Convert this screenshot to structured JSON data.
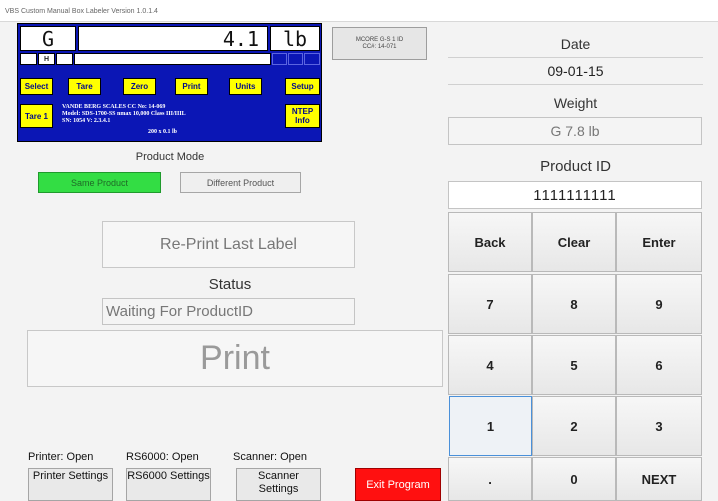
{
  "window": {
    "title": "VBS Custom Manual Box Labeler Version 1.0.1.4"
  },
  "indicator": {
    "mode_letter": "G",
    "weight": "4.1",
    "unit": "lb",
    "annunciator": "H",
    "keys": {
      "select": "Select",
      "tare": "Tare",
      "zero": "Zero",
      "print": "Print",
      "units": "Units",
      "setup": "Setup",
      "tare_one": "Tare 1",
      "ntep_info": "NTEP Info"
    },
    "spec_lines": [
      "VANDE BERG SCALES   CC No: 14-069",
      "Model: SDS-1700-SS   nmax 10,000  Class III/IIIL",
      "SN: 1054   V: 2.3.4.1"
    ],
    "capacity": "200 x 0.1 lb"
  },
  "mcore": {
    "line1": "MCORE G-S 1 ID",
    "line2": "CC#: 14-071"
  },
  "product_mode": {
    "label": "Product Mode",
    "same": "Same Product",
    "different": "Different Product"
  },
  "reprint_label": "Re-Print Last Label",
  "status": {
    "label": "Status",
    "value": "Waiting For ProductID"
  },
  "print_label": "Print",
  "devices": {
    "printer_status": "Printer: Open",
    "rs6000_status": "RS6000: Open",
    "scanner_status": "Scanner: Open",
    "printer_settings": "Printer Settings",
    "rs6000_settings": "RS6000 Settings",
    "scanner_settings": "Scanner Settings"
  },
  "exit_label": "Exit Program",
  "right_panel": {
    "date_label": "Date",
    "date_value": "09-01-15",
    "weight_label": "Weight",
    "weight_value": "G 7.8 lb",
    "product_id_label": "Product ID",
    "product_id_value": "1111111111"
  },
  "keypad": {
    "back": "Back",
    "clear": "Clear",
    "enter": "Enter",
    "k7": "7",
    "k8": "8",
    "k9": "9",
    "k4": "4",
    "k5": "5",
    "k6": "6",
    "k1": "1",
    "k2": "2",
    "k3": "3",
    "dot": ".",
    "k0": "0",
    "next": "NEXT"
  }
}
